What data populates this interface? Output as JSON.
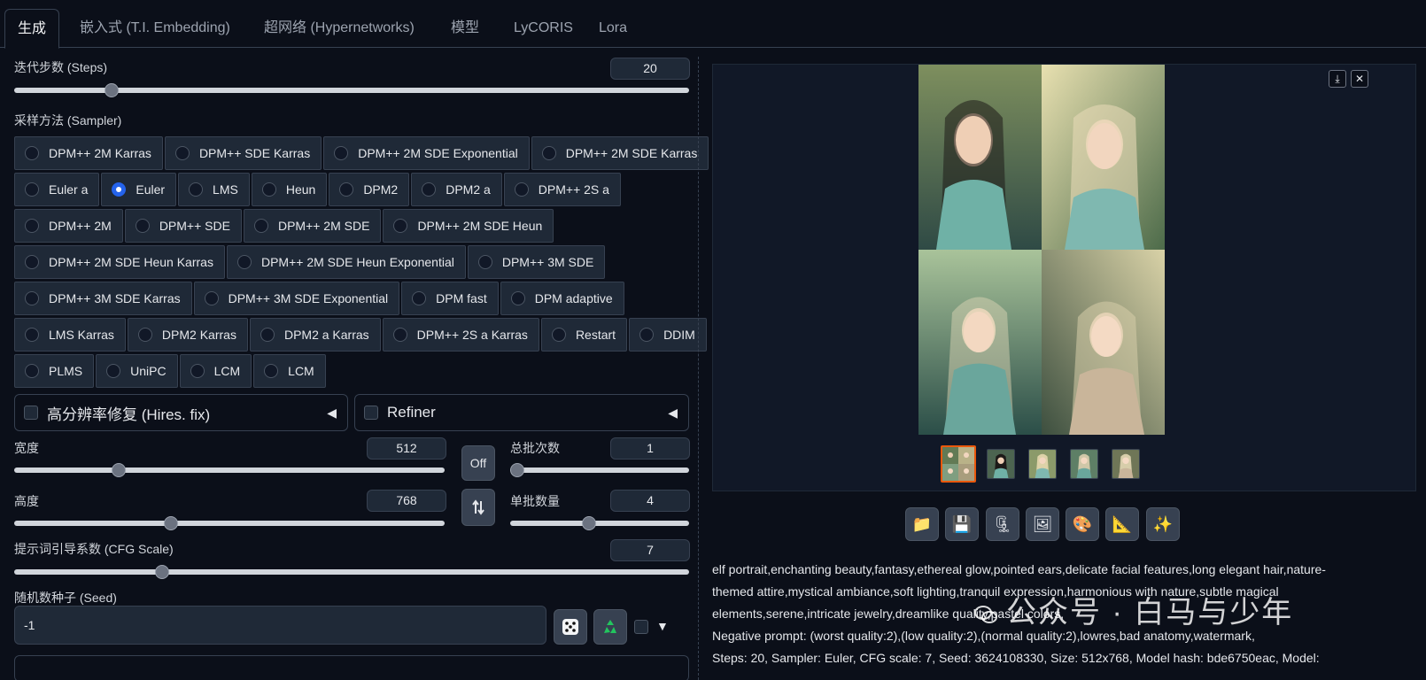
{
  "tabs": [
    "生成",
    "嵌入式 (T.I. Embedding)",
    "超网络 (Hypernetworks)",
    "模型",
    "LyCORIS",
    "Lora"
  ],
  "steps": {
    "label": "迭代步数 (Steps)",
    "value": "20",
    "fraction": 0.137
  },
  "sampler": {
    "label": "采样方法 (Sampler)",
    "selected": "Euler",
    "rows": [
      [
        "DPM++ 2M Karras",
        "DPM++ SDE Karras",
        "DPM++ 2M SDE Exponential",
        "DPM++ 2M SDE Karras"
      ],
      [
        "Euler a",
        "Euler",
        "LMS",
        "Heun",
        "DPM2",
        "DPM2 a",
        "DPM++ 2S a"
      ],
      [
        "DPM++ 2M",
        "DPM++ SDE",
        "DPM++ 2M SDE",
        "DPM++ 2M SDE Heun"
      ],
      [
        "DPM++ 2M SDE Heun Karras",
        "DPM++ 2M SDE Heun Exponential",
        "DPM++ 3M SDE"
      ],
      [
        "DPM++ 3M SDE Karras",
        "DPM++ 3M SDE Exponential",
        "DPM fast",
        "DPM adaptive"
      ],
      [
        "LMS Karras",
        "DPM2 Karras",
        "DPM2 a Karras",
        "DPM++ 2S a Karras",
        "Restart",
        "DDIM"
      ],
      [
        "PLMS",
        "UniPC",
        "LCM",
        "LCM"
      ]
    ]
  },
  "hires": {
    "label": "高分辨率修复 (Hires. fix)",
    "arrow": "◀"
  },
  "refiner": {
    "label": "Refiner",
    "arrow": "◀"
  },
  "width": {
    "label": "宽度",
    "value": "512",
    "fraction": 0.235
  },
  "height": {
    "label": "高度",
    "value": "768",
    "fraction": 0.36
  },
  "off_button": "Off",
  "swap_icon": "swap-arrows-icon",
  "batch_count": {
    "label": "总批次数",
    "value": "1",
    "fraction": 0.0
  },
  "batch_size": {
    "label": "单批数量",
    "value": "4",
    "fraction": 0.435
  },
  "cfg": {
    "label": "提示词引导系数 (CFG Scale)",
    "value": "7",
    "fraction": 0.213
  },
  "seed": {
    "label": "随机数种子 (Seed)",
    "value": "-1",
    "extra_arrow": "▼"
  },
  "gallery": {
    "download_icon": "download-icon",
    "close_icon": "close-icon",
    "close": "✕",
    "download": "⤓"
  },
  "toolbar": [
    "📁",
    "💾",
    "🗜",
    "🖼",
    "🎨",
    "📐",
    "✨"
  ],
  "toolbar_names": [
    "folder-icon",
    "save-icon",
    "zip-icon",
    "image-icon",
    "palette-icon",
    "triangle-ruler-icon",
    "sparkle-icon"
  ],
  "info": {
    "prompt": "elf portrait,enchanting beauty,fantasy,ethereal glow,pointed ears,delicate facial features,long elegant hair,nature-themed attire,mystical ambiance,soft lighting,tranquil expression,harmonious with nature,subtle magical elements,serene,intricate jewelry,dreamlike quality,pastel colors,",
    "negative": "Negative prompt: (worst quality:2),(low quality:2),(normal quality:2),lowres,bad anatomy,watermark,",
    "params": "Steps: 20, Sampler: Euler, CFG scale: 7, Seed: 3624108330, Size: 512x768, Model hash: bde6750eac, Model:"
  },
  "watermark": "公众号 · 白马与少年",
  "colors": {
    "accent": "#2563eb",
    "thumb_selected": "#ea580c",
    "background": "#0b0f19"
  }
}
